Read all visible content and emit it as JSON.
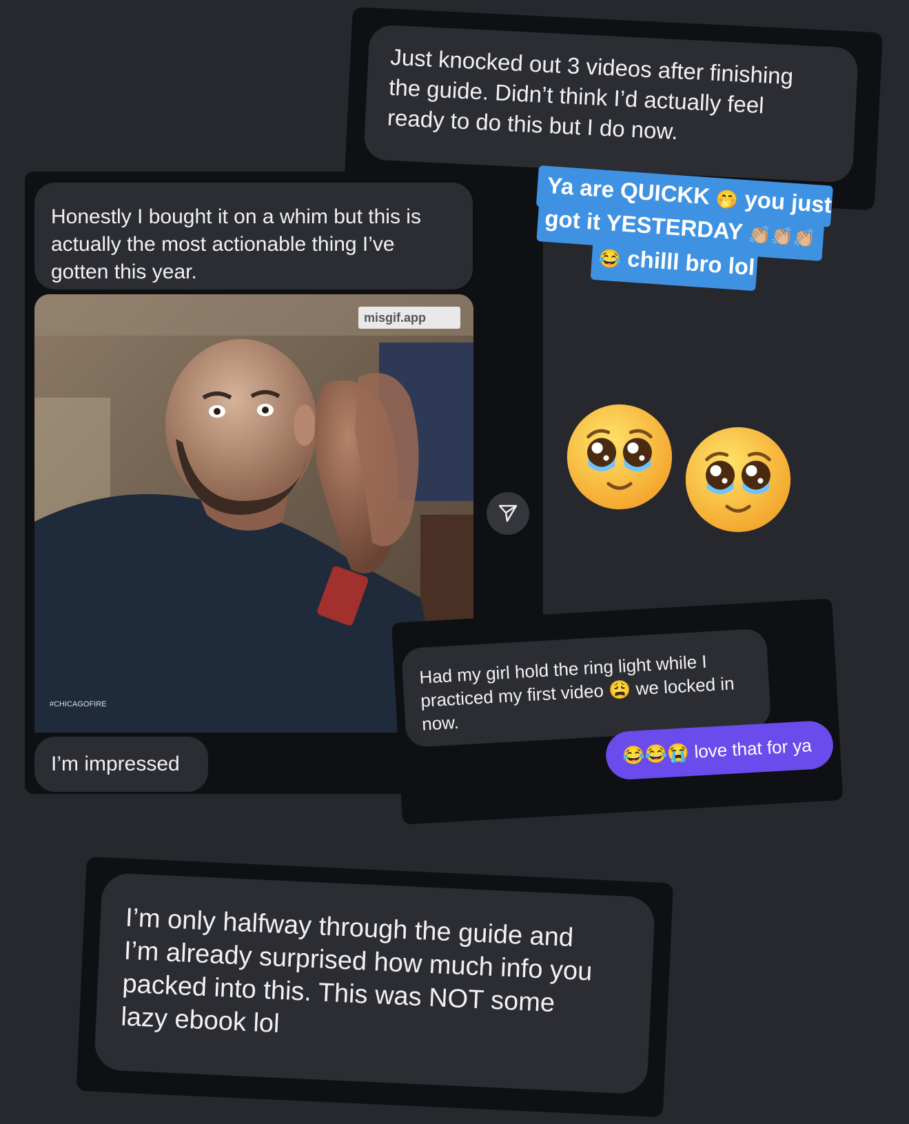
{
  "top_message": {
    "lines": [
      "Just knocked out 3 videos after finishing",
      "the guide. Didn’t think I’d actually feel",
      "ready to do this but I do now."
    ]
  },
  "left_chat": {
    "message1_lines": [
      "Honestly I bought it on a whim but this is",
      "actually the most actionable thing I’ve",
      "gotten this year."
    ],
    "gif": {
      "watermark": "misgif.app",
      "caption": "#CHICAGOFIRE"
    },
    "message2": "I’m impressed"
  },
  "story_sticker": {
    "line1": "Ya are QUICKK",
    "line1_emoji": "🤭",
    "line1_end": "you just",
    "line2": "got it YESTERDAY",
    "line2_emoji": "👏🏼👏🏼👏🏼",
    "line3_emoji": "😂",
    "line3": "chilll bro lol"
  },
  "reaction": {
    "icon": "pleading-face-icon",
    "emoji": "🥹🥹"
  },
  "mid_chat": {
    "line1": "Had my girl hold the ring light while I",
    "line2": "practiced my first video",
    "line2_emoji": "😩",
    "line2_end": "we locked in",
    "line3": "now.",
    "reply_emoji": "😂😂😭",
    "reply_text": "love that for ya"
  },
  "bottom_message": {
    "lines": [
      "I’m only halfway through the guide and",
      "I’m already surprised how much info you",
      "packed into this. This was NOT some",
      "lazy ebook lol"
    ]
  },
  "colors": {
    "page_bg": "#26282d",
    "card_bg": "#0e1014",
    "bubble_bg": "#2b2d33",
    "sticker_blue": "#3f92e1",
    "reply_purple": "#6a4bec"
  }
}
